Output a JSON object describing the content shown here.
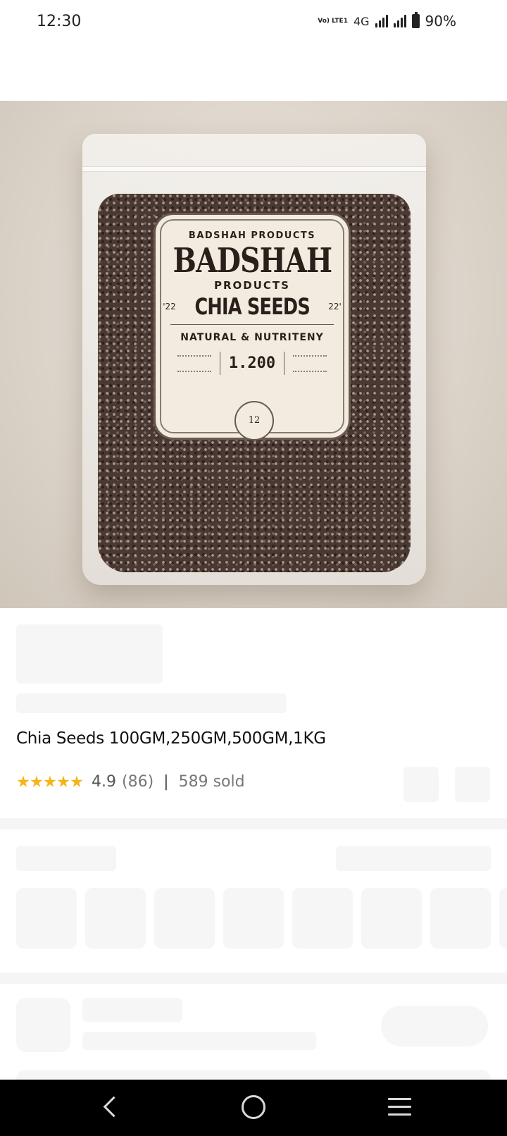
{
  "status_bar": {
    "time": "12:30",
    "volte": "Vo) LTE1",
    "network": "4G",
    "battery": "90%"
  },
  "product_image": {
    "label_top": "BADSHAH PRODUCTS",
    "label_brand": "BADSHAH",
    "label_products": "PRODUCTS",
    "label_side_left": "'22",
    "label_main": "CHIA SEEDS",
    "label_side_right": "22'",
    "label_tagline": "NATURAL & NUTRITENY",
    "label_weight": "1.200",
    "label_badge": "12"
  },
  "product": {
    "title": "Chia Seeds 100GM,250GM,500GM,1KG",
    "rating": 5,
    "rating_value": "4.9",
    "rating_count": "(86)",
    "divider": "|",
    "sold": "589 sold"
  },
  "nav_bar": {
    "back_icon": "back-icon",
    "home_icon": "home-icon",
    "menu_icon": "menu-icon"
  }
}
